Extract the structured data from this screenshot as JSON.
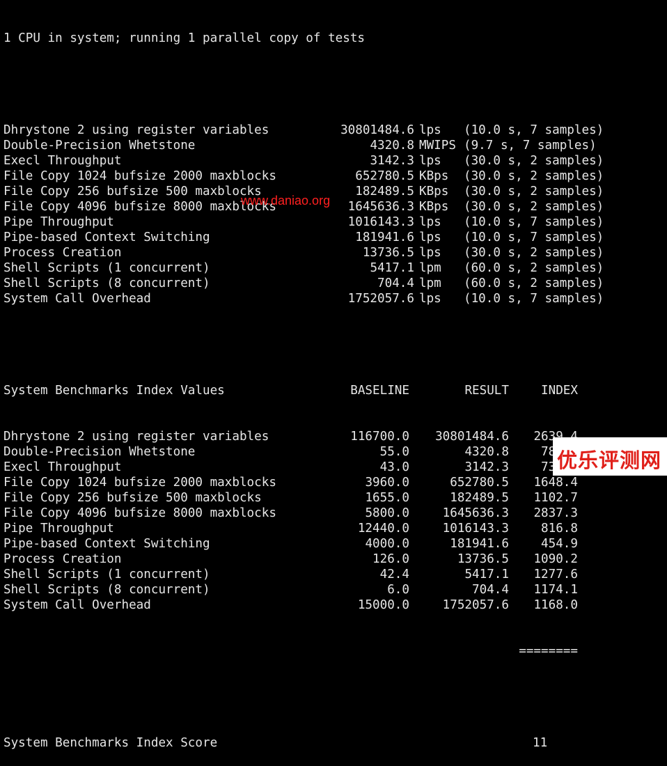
{
  "header": "1 CPU in system; running 1 parallel copy of tests",
  "results": [
    {
      "name": "Dhrystone 2 using register variables",
      "value": "30801484.6",
      "unit": "lps",
      "meta": "(10.0 s, 7 samples)"
    },
    {
      "name": "Double-Precision Whetstone",
      "value": "4320.8",
      "unit": "MWIPS",
      "meta": "(9.7 s, 7 samples)"
    },
    {
      "name": "Execl Throughput",
      "value": "3142.3",
      "unit": "lps",
      "meta": "(30.0 s, 2 samples)"
    },
    {
      "name": "File Copy 1024 bufsize 2000 maxblocks",
      "value": "652780.5",
      "unit": "KBps",
      "meta": "(30.0 s, 2 samples)"
    },
    {
      "name": "File Copy 256 bufsize 500 maxblocks",
      "value": "182489.5",
      "unit": "KBps",
      "meta": "(30.0 s, 2 samples)"
    },
    {
      "name": "File Copy 4096 bufsize 8000 maxblocks",
      "value": "1645636.3",
      "unit": "KBps",
      "meta": "(30.0 s, 2 samples)"
    },
    {
      "name": "Pipe Throughput",
      "value": "1016143.3",
      "unit": "lps",
      "meta": "(10.0 s, 7 samples)"
    },
    {
      "name": "Pipe-based Context Switching",
      "value": "181941.6",
      "unit": "lps",
      "meta": "(10.0 s, 7 samples)"
    },
    {
      "name": "Process Creation",
      "value": "13736.5",
      "unit": "lps",
      "meta": "(30.0 s, 2 samples)"
    },
    {
      "name": "Shell Scripts (1 concurrent)",
      "value": "5417.1",
      "unit": "lpm",
      "meta": "(60.0 s, 2 samples)"
    },
    {
      "name": "Shell Scripts (8 concurrent)",
      "value": "704.4",
      "unit": "lpm",
      "meta": "(60.0 s, 2 samples)"
    },
    {
      "name": "System Call Overhead",
      "value": "1752057.6",
      "unit": "lps",
      "meta": "(10.0 s, 7 samples)"
    }
  ],
  "index_table": {
    "title": "System Benchmarks Index Values",
    "headers": [
      "BASELINE",
      "RESULT",
      "INDEX"
    ],
    "rows": [
      {
        "name": "Dhrystone 2 using register variables",
        "baseline": "116700.0",
        "result": "30801484.6",
        "index": "2639.4"
      },
      {
        "name": "Double-Precision Whetstone",
        "baseline": "55.0",
        "result": "4320.8",
        "index": "785.6"
      },
      {
        "name": "Execl Throughput",
        "baseline": "43.0",
        "result": "3142.3",
        "index": "730.8"
      },
      {
        "name": "File Copy 1024 bufsize 2000 maxblocks",
        "baseline": "3960.0",
        "result": "652780.5",
        "index": "1648.4"
      },
      {
        "name": "File Copy 256 bufsize 500 maxblocks",
        "baseline": "1655.0",
        "result": "182489.5",
        "index": "1102.7"
      },
      {
        "name": "File Copy 4096 bufsize 8000 maxblocks",
        "baseline": "5800.0",
        "result": "1645636.3",
        "index": "2837.3"
      },
      {
        "name": "Pipe Throughput",
        "baseline": "12440.0",
        "result": "1016143.3",
        "index": "816.8"
      },
      {
        "name": "Pipe-based Context Switching",
        "baseline": "4000.0",
        "result": "181941.6",
        "index": "454.9"
      },
      {
        "name": "Process Creation",
        "baseline": "126.0",
        "result": "13736.5",
        "index": "1090.2"
      },
      {
        "name": "Shell Scripts (1 concurrent)",
        "baseline": "42.4",
        "result": "5417.1",
        "index": "1277.6"
      },
      {
        "name": "Shell Scripts (8 concurrent)",
        "baseline": "6.0",
        "result": "704.4",
        "index": "1174.1"
      },
      {
        "name": "System Call Overhead",
        "baseline": "15000.0",
        "result": "1752057.6",
        "index": "1168.0"
      }
    ],
    "separator": "========",
    "score_label": "System Benchmarks Index Score",
    "score_visible": "11"
  },
  "watermark": "www.daniao.org",
  "logo": "优乐评测网",
  "colors": {
    "background": "#000000",
    "text": "#e6e6e6",
    "watermark": "#ff2020",
    "logo": "#e0201a"
  }
}
